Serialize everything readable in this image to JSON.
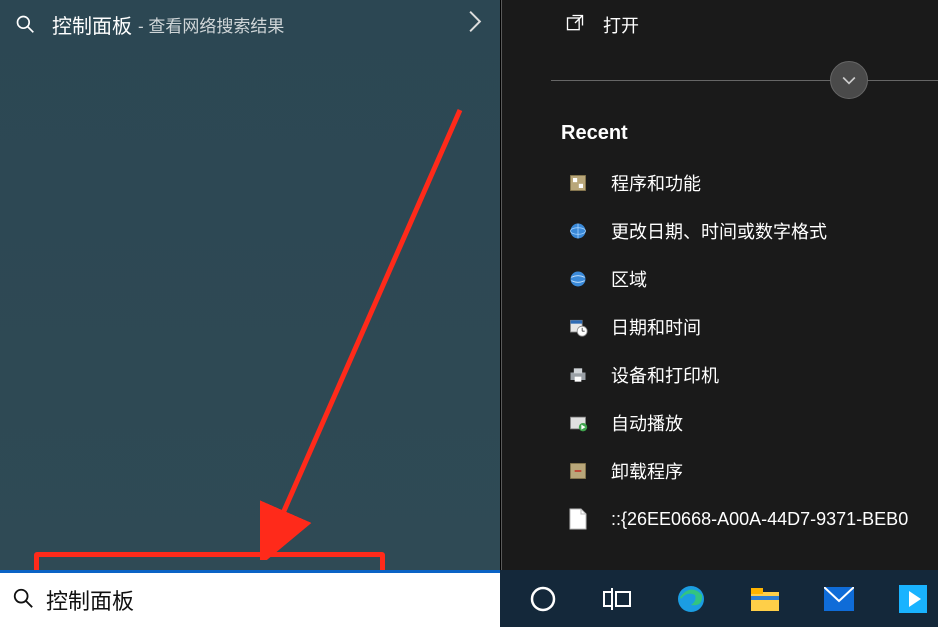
{
  "search_result": {
    "title": "控制面板",
    "subtitle": "- 查看网络搜索结果"
  },
  "right": {
    "open_label": "打开",
    "recent_heading": "Recent",
    "items": [
      {
        "icon": "programs-features-icon",
        "label": "程序和功能"
      },
      {
        "icon": "region-settings-icon",
        "label": "更改日期、时间或数字格式"
      },
      {
        "icon": "region-icon",
        "label": "区域"
      },
      {
        "icon": "date-time-icon",
        "label": "日期和时间"
      },
      {
        "icon": "devices-printers-icon",
        "label": "设备和打印机"
      },
      {
        "icon": "autoplay-icon",
        "label": "自动播放"
      },
      {
        "icon": "uninstall-icon",
        "label": "卸载程序"
      },
      {
        "icon": "file-icon",
        "label": "::{26EE0668-A00A-44D7-9371-BEB0"
      }
    ]
  },
  "taskbar": {
    "search_value": "控制面板"
  }
}
